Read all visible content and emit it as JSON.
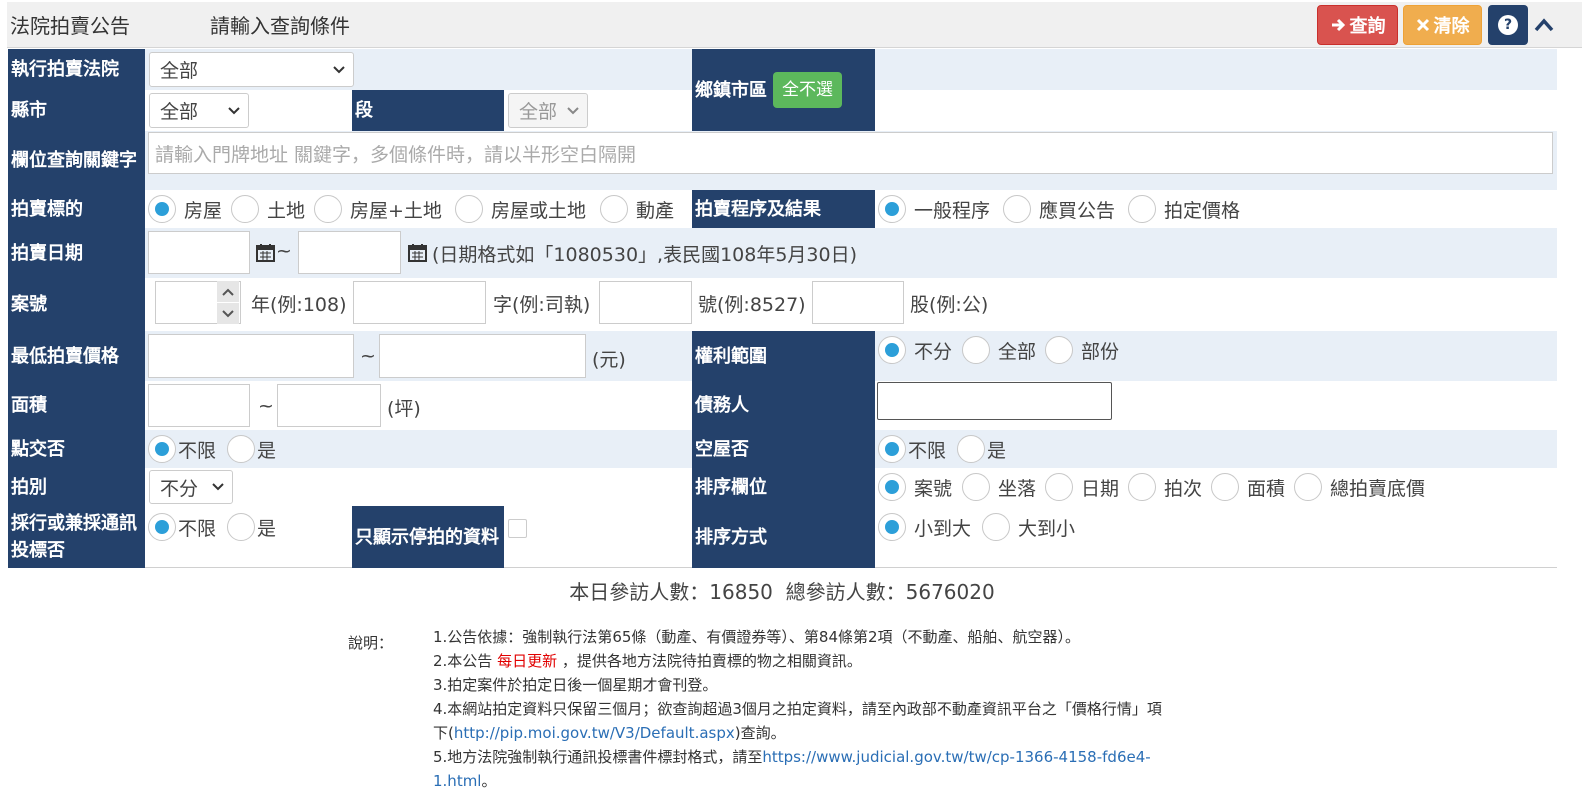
{
  "header": {
    "title": "法院拍賣公告",
    "subtitle": "請輸入查詢條件",
    "query_label": "查詢",
    "clear_label": "清除",
    "help_label": "?"
  },
  "form": {
    "court": {
      "label": "執行拍賣法院",
      "value": "全部"
    },
    "township": {
      "label": "鄉鎮市區",
      "button": "全不選"
    },
    "county": {
      "label": "縣市",
      "value": "全部"
    },
    "section": {
      "label": "段",
      "value": "全部"
    },
    "keyword": {
      "label": "欄位查詢關鍵字",
      "placeholder": "請輸入門牌地址 關鍵字，多個條件時，請以半形空白隔開"
    },
    "target": {
      "label": "拍賣標的",
      "options": [
        "房屋",
        "土地",
        "房屋+土地",
        "房屋或土地",
        "動產"
      ]
    },
    "procedure": {
      "label": "拍賣程序及結果",
      "options": [
        "一般程序",
        "應買公告",
        "拍定價格"
      ]
    },
    "date": {
      "label": "拍賣日期",
      "tilde": "~",
      "hint": "(日期格式如「1080530」,表民國108年5月30日)"
    },
    "case": {
      "label": "案號",
      "year": "年(例:108)",
      "word": "字(例:司執)",
      "number": "號(例:8527)",
      "unit": "股(例:公)"
    },
    "price": {
      "label": "最低拍賣價格",
      "tilde": "~",
      "unit": "(元)"
    },
    "rights": {
      "label": "權利範圍",
      "options": [
        "不分",
        "全部",
        "部份"
      ]
    },
    "area": {
      "label": "面積",
      "tilde": "~",
      "unit": "(坪)"
    },
    "debtor": {
      "label": "債務人"
    },
    "handover": {
      "label": "點交否",
      "options": [
        "不限",
        "是"
      ]
    },
    "vacant": {
      "label": "空屋否",
      "options": [
        "不限",
        "是"
      ]
    },
    "round": {
      "label": "拍別",
      "value": "不分"
    },
    "sort_field": {
      "label": "排序欄位",
      "options": [
        "案號",
        "坐落",
        "日期",
        "拍次",
        "面積",
        "總拍賣底價"
      ]
    },
    "tender": {
      "label": "採行或兼採通訊投標否",
      "options": [
        "不限",
        "是"
      ]
    },
    "suspended": {
      "label": "只顯示停拍的資料"
    },
    "sort_order": {
      "label": "排序方式",
      "options": [
        "小到大",
        "大到小"
      ]
    }
  },
  "stats": {
    "text": "本日參訪人數：16850  總參訪人數：5676020"
  },
  "notes": {
    "label": "說明：",
    "line1": "1.公告依據：強制執行法第65條（動產、有價證券等）、第84條第2項（不動產、船舶、航空器）。",
    "line2_a": "2.本公告",
    "line2_b": "每日更新",
    "line2_c": "，提供各地方法院待拍賣標的物之相關資訊。",
    "line3": "3.拍定案件於拍定日後一個星期才會刊登。",
    "line4_a": "4.本網站拍定資料只保留三個月；欲查詢超過3個月之拍定資料，請至內政部不動產資訊平台之「價格行情」項",
    "line4_b": "下(",
    "line4_link": "http://pip.moi.gov.tw/V3/Default.aspx",
    "line4_c": ")查詢。",
    "line5_a": "5.地方法院強制執行通訊投標書件標封格式，請至",
    "line5_link1": "https://www.judicial.gov.tw/tw/cp-1366-4158-fd6e4-",
    "line5_link2": "1.html",
    "line5_end": "。"
  }
}
